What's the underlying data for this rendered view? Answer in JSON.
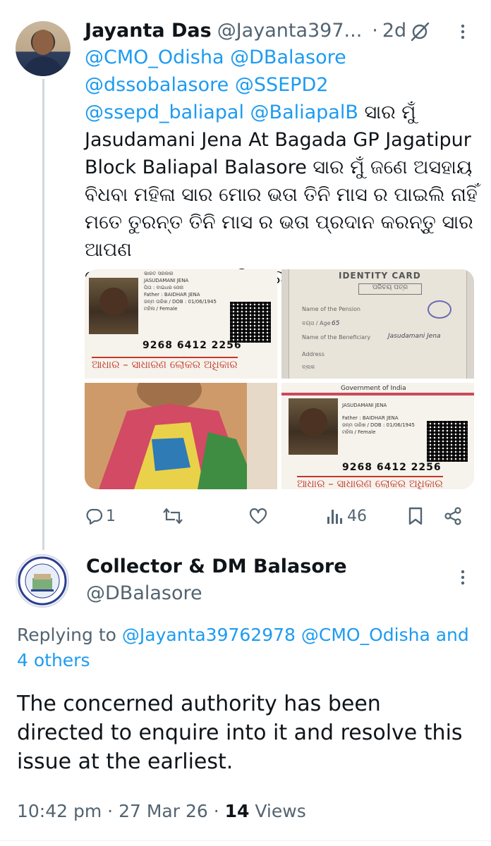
{
  "tweet": {
    "author_name": "Jayanta Das",
    "author_handle": "@Jayanta397...",
    "separator": "·",
    "time": "2d",
    "text_lines": [
      "@CMO_Odisha @DBalasore",
      "@dssobalasore @SSEPD2",
      "@ssepd_baliapal @BaliapalB ସାର ମୁଁ",
      "Jasudamani Jena At Bagada GP Jagatipur",
      "Block Baliapal Balasore ସାର ମୁଁ ଜଣେ ଅସହାୟ",
      "ବିଧବା ମହିଳା ସାର ମୋର ଭତା ତିନି ମାସ ର ପାଇଲି ନାହିଁ",
      "ମତେ ତୁରନ୍ତ ତିନି ମାସ ର ଭତା ପ୍ରଦାନ କରନ୍ତୁ ସାର ଆପଣ",
      "ଙ୍କୁ ଅନୁରୋଧ କରୁଅଛି ସାର"
    ],
    "mentions": {
      "m1": "@CMO_Odisha",
      "m2": "@DBalasore",
      "m3": "@dssobalasore",
      "m4": "@SSEPD2",
      "m5": "@ssepd_baliapal",
      "m6": "@BaliapalB",
      "l3_rest": "ସାର ମୁଁ"
    },
    "media": {
      "aadhaar": {
        "header": "ଭାରତ ସରକାର",
        "name": "JASUDAMANI JENA",
        "rel_label": "ପିତା : ବାଇଧର ଜେନା",
        "father": "Father : BAIDHAR JENA",
        "dob": "ଜନ୍ମ ତାରିଖ / DOB : 01/06/1945",
        "gender": "ମହିଳା / Female",
        "number": "9268 6412 2256",
        "footer": "ଆଧାର – ସାଧାରଣ ଲୋକର ଅଧିକାର"
      },
      "aadhaar2": {
        "header": "Government of India"
      },
      "id_card": {
        "title": "IDENTITY CARD",
        "subtitle": "ପରିଚୟ ପତ୍ର",
        "rows": [
          "Name of the Pension",
          "ବୟସ / Age",
          "Name of the Beneficiary",
          "Address",
          "ବ୍ଲକ"
        ],
        "hand_name": "Jasudamani Jena",
        "age": "65"
      }
    },
    "actions": {
      "reply_count": "1",
      "views_count": "46"
    },
    "colors": {
      "link": "#1d9bf0",
      "secondary": "#536471",
      "primary": "#0f1419"
    }
  },
  "reply": {
    "author_name": "Collector & DM Balasore",
    "author_handle": "@DBalasore",
    "replying_prefix": "Replying to",
    "replying_handles": "@Jayanta39762978 @CMO_Odisha and",
    "replying_more": "4 others",
    "text": "The concerned authority has been directed to enquire into it and resolve this issue at the earliest.",
    "time": "10:42 pm",
    "date": "27 Mar 26",
    "views_count": "14",
    "views_label": "Views",
    "separator": "·"
  },
  "icons": [
    "grok-icon",
    "more-icon",
    "reply-icon",
    "retweet-icon",
    "like-icon",
    "views-icon",
    "bookmark-icon",
    "share-icon"
  ]
}
